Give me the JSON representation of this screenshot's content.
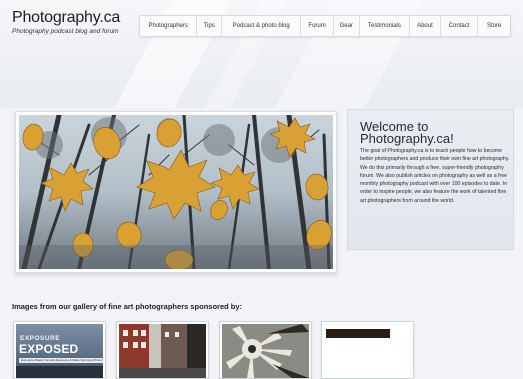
{
  "header": {
    "logo": "Photography.ca",
    "tagline": "Photography podcast blog and forum",
    "nav": [
      {
        "label": "Photographers"
      },
      {
        "label": "Tips"
      },
      {
        "label": "Podcast & photo blog"
      },
      {
        "label": "Forum"
      },
      {
        "label": "Gear"
      },
      {
        "label": "Testimonials"
      },
      {
        "label": "About"
      },
      {
        "label": "Contact"
      },
      {
        "label": "Store"
      }
    ]
  },
  "welcome": {
    "title": "Welcome to Photography.ca!",
    "body": "The goal of Photography.ca is to teach people how to become better photographers and produce their own fine art photography. We do this primarily through a free, super-friendly photography forum. We also publish articles on photography as well as a free monthly photography podcast with over 100 episodes to date. In order to inspire people, we also feature the work of talented fine art photographers from around the world."
  },
  "gallery": {
    "heading": "Images from our gallery of fine art photographers sponsored by:",
    "thumbs": [
      {
        "cover_line1": "EXPOSURE",
        "cover_line2": "EXPOSED",
        "cover_sub": "Exposure Master Camera Exposure & Make Stunning Photos"
      },
      {},
      {},
      {}
    ]
  },
  "colors": {
    "page_bg": "#f2f3f6",
    "title_text": "#1e2a3a",
    "leaf": "#d9a033"
  }
}
